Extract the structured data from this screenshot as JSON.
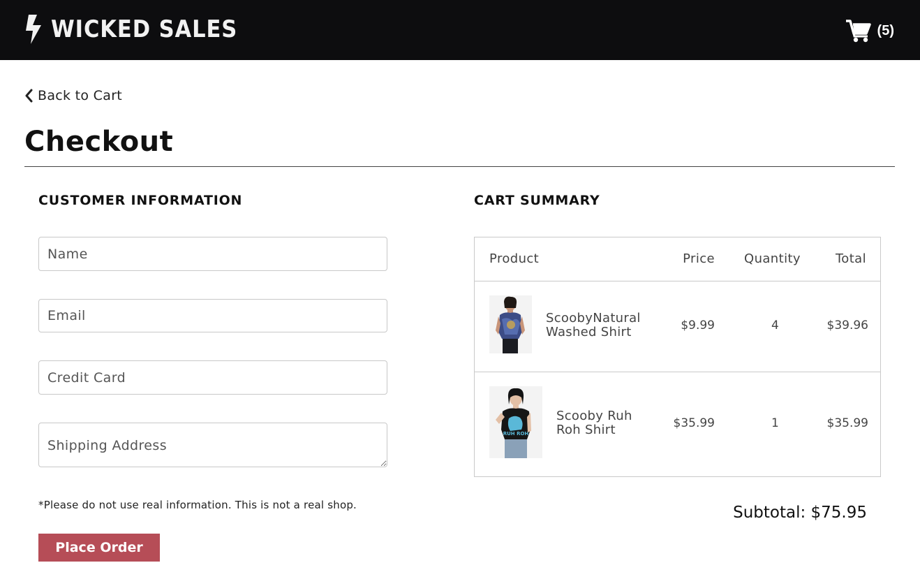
{
  "header": {
    "brand_name": "WICKED SALES",
    "cart_count": "(5)",
    "colors": {
      "bar": "#0d0d0f",
      "text": "#f2f2f2"
    }
  },
  "nav": {
    "back_label": "Back to Cart"
  },
  "page": {
    "title": "Checkout"
  },
  "customer_info": {
    "heading": "CUSTOMER INFORMATION",
    "fields": {
      "name": {
        "value": "",
        "placeholder": "Name"
      },
      "email": {
        "value": "",
        "placeholder": "Email"
      },
      "credit_card": {
        "value": "",
        "placeholder": "Credit Card"
      },
      "shipping_address": {
        "value": "",
        "placeholder": "Shipping Address"
      }
    },
    "disclaimer": "*Please do not use real information. This is not a real shop.",
    "submit_label": "Place Order",
    "submit_color": "#b64d57"
  },
  "cart_summary": {
    "heading": "CART SUMMARY",
    "columns": {
      "product": "Product",
      "price": "Price",
      "quantity": "Quantity",
      "total": "Total"
    },
    "items": [
      {
        "name": "ScoobyNatural Washed Shirt",
        "price": "$9.99",
        "quantity": "4",
        "total": "$39.96",
        "image": "tie-dye-shirt-photo"
      },
      {
        "name": "Scooby Ruh Roh Shirt",
        "price": "$35.99",
        "quantity": "1",
        "total": "$35.99",
        "image": "black-scooby-shirt-photo"
      }
    ],
    "subtotal": "Subtotal: $75.95"
  },
  "icons": [
    "lightning-bolt-icon",
    "shopping-cart-icon",
    "chevron-left-icon"
  ]
}
